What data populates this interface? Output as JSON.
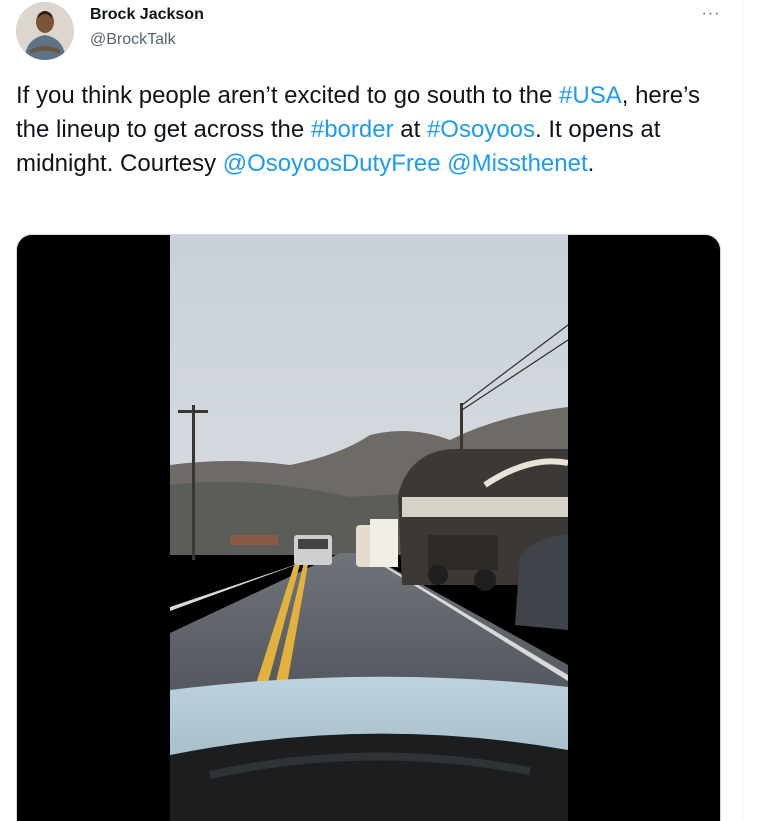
{
  "author": {
    "name": "Brock Jackson",
    "handle": "@BrockTalk"
  },
  "more_menu": {
    "label": "···",
    "icon": "more-horizontal-icon"
  },
  "tweet": {
    "segments": [
      {
        "text": "If you think people aren’t excited to go south to the ",
        "link": false
      },
      {
        "text": "#USA",
        "link": true
      },
      {
        "text": ", here’s the lineup to get across the ",
        "link": false
      },
      {
        "text": "#border",
        "link": true
      },
      {
        "text": " at ",
        "link": false
      },
      {
        "text": "#Osoyoos",
        "link": true
      },
      {
        "text": ". It opens at midnight. Courtesy ",
        "link": false
      },
      {
        "text": "@OsoyoosDutyFree",
        "link": true
      },
      {
        "text": " ",
        "link": false
      },
      {
        "text": "@Missthenet",
        "link": true
      },
      {
        "text": ".",
        "link": false
      }
    ]
  },
  "colors": {
    "link": "#1d9bf0",
    "text": "#0f1419",
    "secondary": "#536471",
    "media_background": "#000000"
  }
}
